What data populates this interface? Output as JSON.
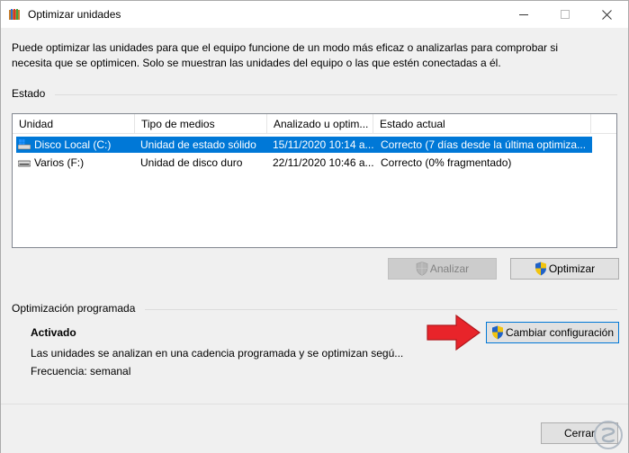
{
  "window": {
    "title": "Optimizar unidades",
    "description_line1": "Puede optimizar las unidades para que el equipo funcione de un modo más eficaz o analizarlas para comprobar si",
    "description_line2": "necesita que se optimicen. Solo se muestran las unidades del equipo o las que estén conectadas a él."
  },
  "status_section": {
    "label": "Estado",
    "columns": [
      "Unidad",
      "Tipo de medios",
      "Analizado u optim...",
      "Estado actual"
    ],
    "rows": [
      {
        "unit": "Disco Local (C:)",
        "media": "Unidad de estado sólido",
        "analyzed": "15/11/2020 10:14 a...",
        "status": "Correcto (7 días desde la última optimiza...",
        "selected": true,
        "icon": "windows-drive-icon"
      },
      {
        "unit": "Varios (F:)",
        "media": "Unidad de disco duro",
        "analyzed": "22/11/2020 10:46 a...",
        "status": "Correcto (0% fragmentado)",
        "selected": false,
        "icon": "hard-drive-icon"
      }
    ],
    "analyze_label": "Analizar",
    "optimize_label": "Optimizar"
  },
  "scheduled_section": {
    "label": "Optimización programada",
    "state": "Activado",
    "detail": "Las unidades se analizan en una cadencia programada y se optimizan segú...",
    "frequency": "Frecuencia: semanal",
    "change_label": "Cambiar configuración"
  },
  "footer": {
    "close_label": "Cerrar"
  },
  "colors": {
    "selection": "#0078d7",
    "arrow": "#e8242a"
  }
}
